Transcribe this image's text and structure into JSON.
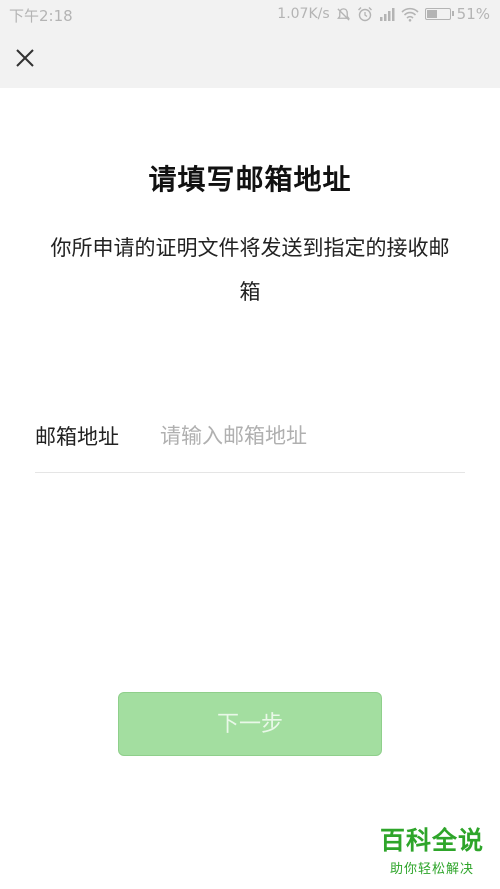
{
  "status_bar": {
    "time": "下午2:18",
    "network_speed": "1.07K/s",
    "battery_percent": "51%",
    "battery_level": 0.51
  },
  "header": {
    "close_icon": "close-icon"
  },
  "page": {
    "title": "请填写邮箱地址",
    "description": "你所申请的证明文件将发送到指定的接收邮箱"
  },
  "form": {
    "email_label": "邮箱地址",
    "email_value": "",
    "email_placeholder": "请输入邮箱地址"
  },
  "actions": {
    "next_label": "下一步"
  },
  "watermark": {
    "title": "百科全说",
    "subtitle": "助你轻松解决"
  },
  "colors": {
    "button_bg": "#a3dea0",
    "watermark": "#2ea52a"
  }
}
